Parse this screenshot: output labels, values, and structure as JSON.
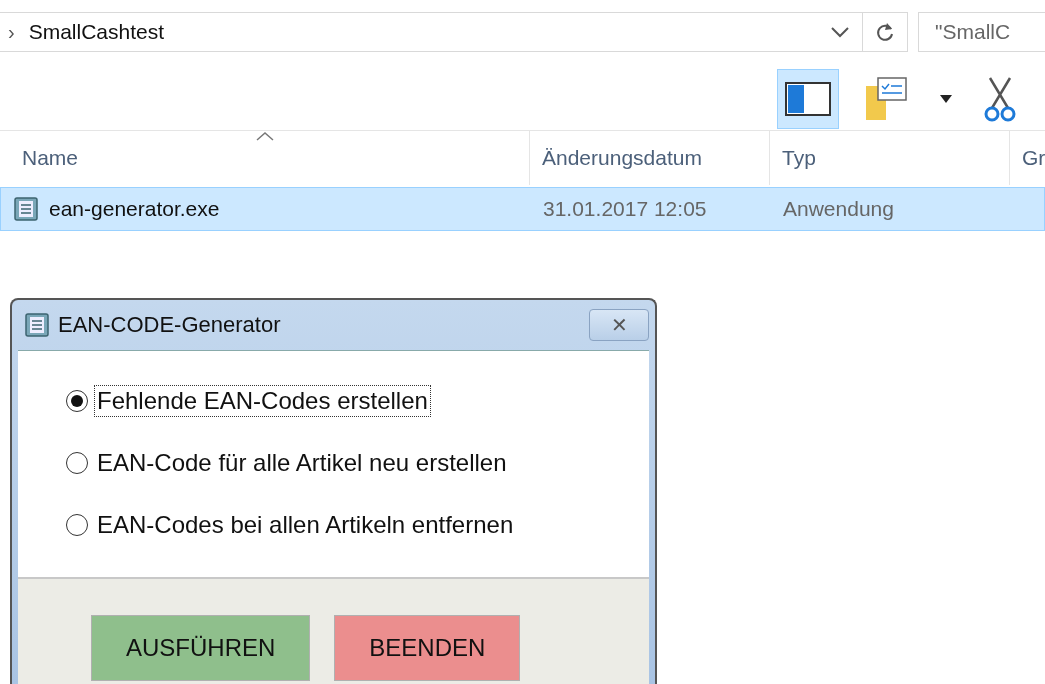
{
  "explorer": {
    "address": {
      "chevron": "›",
      "path": "SmallCashtest"
    },
    "search": {
      "placeholder": "\"SmallC"
    },
    "toolbar": [
      {
        "kind": "preview-pane",
        "selected": true
      },
      {
        "kind": "folder-list",
        "selected": false
      },
      {
        "kind": "dropdown",
        "selected": false
      },
      {
        "kind": "scissors",
        "selected": false
      }
    ],
    "columns": [
      {
        "label": "Name",
        "sorted": true
      },
      {
        "label": "Änderungsdatum",
        "sorted": false
      },
      {
        "label": "Typ",
        "sorted": false
      },
      {
        "label": "Gr",
        "sorted": false
      }
    ],
    "rows": [
      {
        "cells": [
          "ean-generator.exe",
          "31.01.2017 12:05",
          "Anwendung"
        ],
        "selected": true
      }
    ]
  },
  "dialog": {
    "title": "EAN-CODE-Generator",
    "close": "✕",
    "options": [
      {
        "label": "Fehlende EAN-Codes erstellen",
        "selected": true,
        "focused": true
      },
      {
        "label": "EAN-Code für alle Artikel neu erstellen",
        "selected": false,
        "focused": false
      },
      {
        "label": "EAN-Codes bei allen Artikeln entfernen",
        "selected": false,
        "focused": false
      }
    ],
    "buttons": [
      {
        "label": "AUSFÜHREN",
        "color": "#8fbf8c"
      },
      {
        "label": "BEENDEN",
        "color": "#eb8e8e"
      }
    ]
  }
}
